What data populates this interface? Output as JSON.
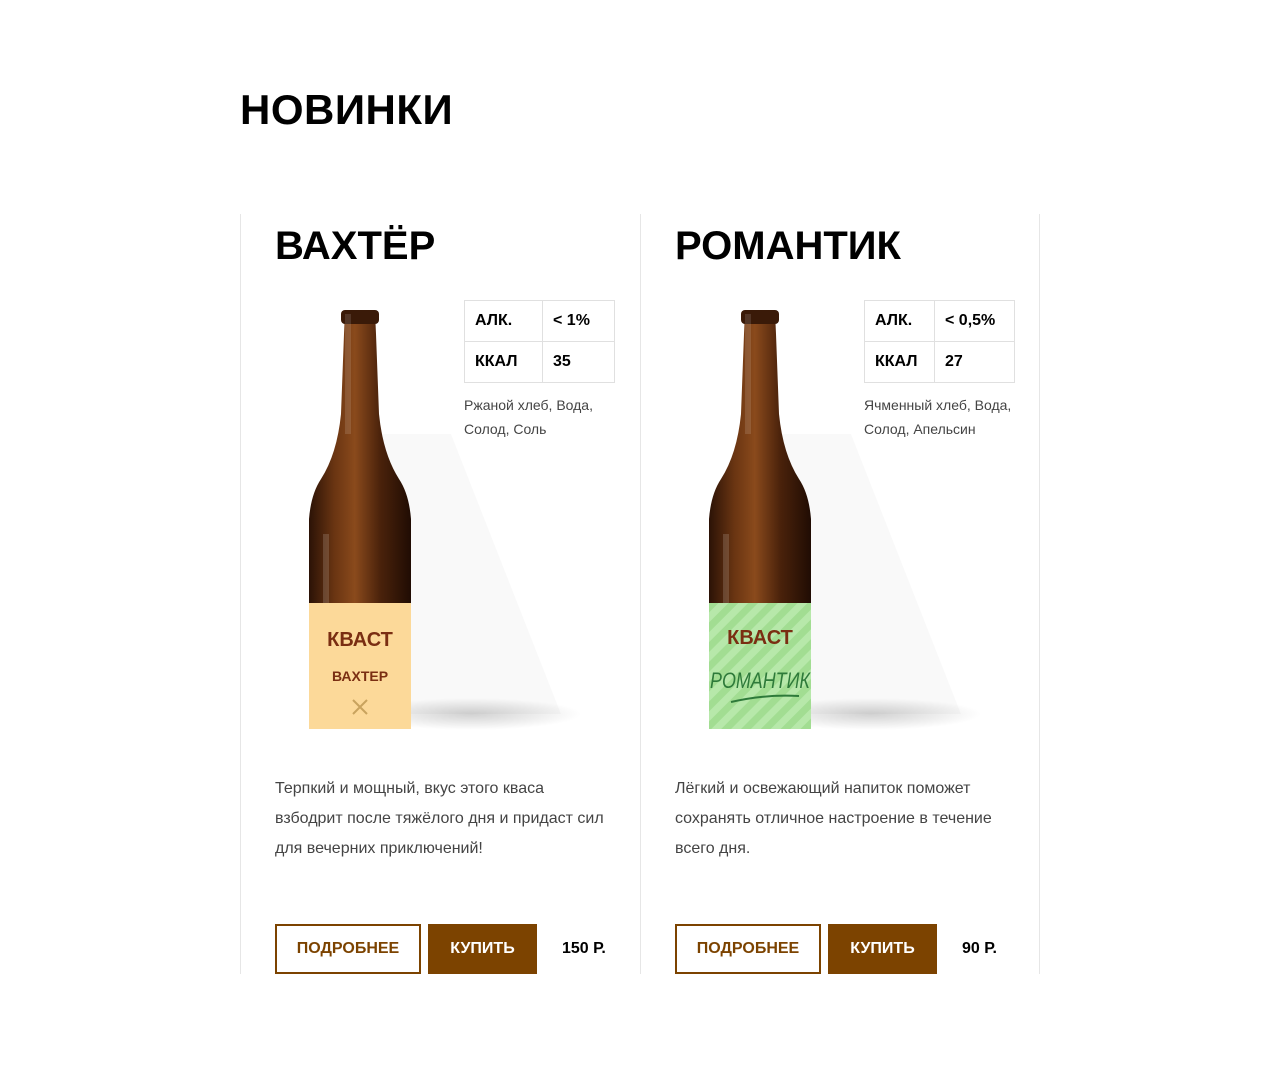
{
  "section": {
    "title": "НОВИНКИ"
  },
  "products": [
    {
      "name": "ВАХТЁР",
      "specs": [
        {
          "label": "АЛК.",
          "value": "< 1%"
        },
        {
          "label": "ККАЛ",
          "value": "35"
        }
      ],
      "ingredients": "Ржаной хлеб, Вода, Солод, Соль",
      "description": "Терпкий и мощный, вкус этого кваса взбодрит после тяжёлого дня и придаст сил для вечерних приключений!",
      "more_label": "ПОДРОБНЕЕ",
      "buy_label": "КУПИТЬ",
      "price": "150 Р.",
      "label_brand": "КВАСТ",
      "label_name": "ВАХТЕР",
      "label_color": "#fcd999",
      "label_text_color": "#7a2e12"
    },
    {
      "name": "РОМАНТИК",
      "specs": [
        {
          "label": "АЛК.",
          "value": "< 0,5%"
        },
        {
          "label": "ККАЛ",
          "value": "27"
        }
      ],
      "ingredients": "Ячменный хлеб, Вода, Солод, Апельсин",
      "description": "Лёгкий и освежающий напиток поможет сохранять отличное настроение в течение всего дня.",
      "more_label": "ПОДРОБНЕЕ",
      "buy_label": "КУПИТЬ",
      "price": "90 Р.",
      "label_brand": "КВАСТ",
      "label_name": "РОМАНТИК",
      "label_color": "#b7e8aa",
      "label_text_color": "#2e7a3a"
    }
  ],
  "colors": {
    "accent": "#7c4300",
    "bottle": "#4a2510"
  }
}
